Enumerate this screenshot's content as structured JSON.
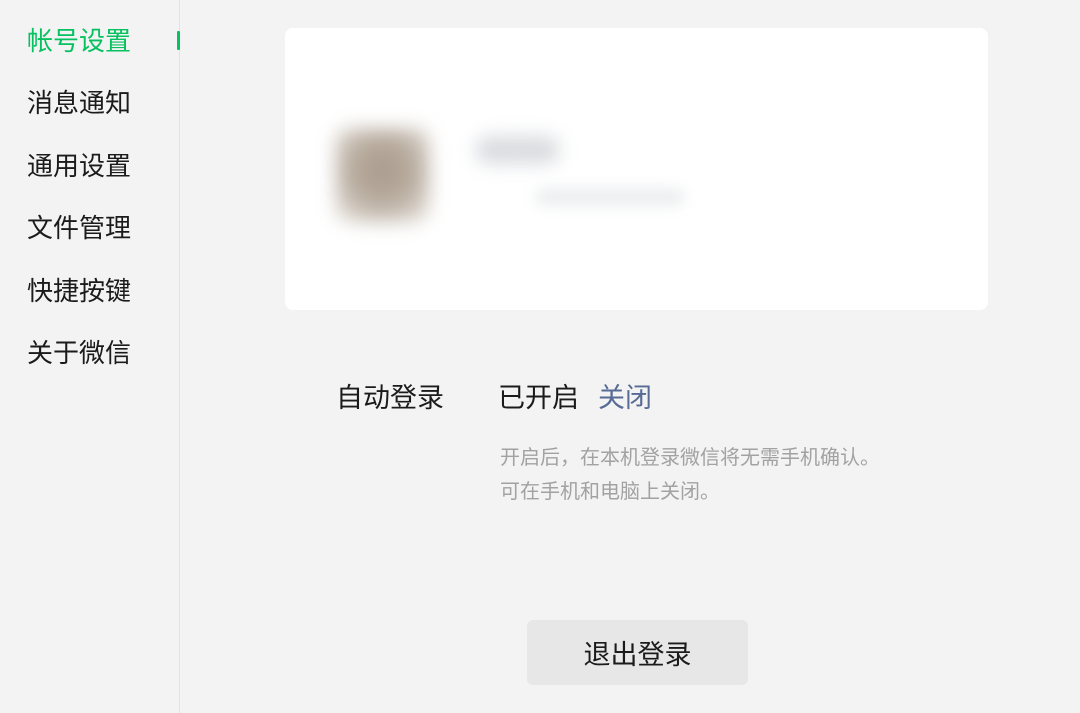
{
  "sidebar": {
    "items": [
      {
        "label": "帐号设置",
        "active": true
      },
      {
        "label": "消息通知",
        "active": false
      },
      {
        "label": "通用设置",
        "active": false
      },
      {
        "label": "文件管理",
        "active": false
      },
      {
        "label": "快捷按键",
        "active": false
      },
      {
        "label": "关于微信",
        "active": false
      }
    ]
  },
  "account": {
    "auto_login": {
      "label": "自动登录",
      "status": "已开启",
      "action": "关闭",
      "hint_line1": "开启后，在本机登录微信将无需手机确认。",
      "hint_line2": "可在手机和电脑上关闭。"
    },
    "logout_label": "退出登录"
  },
  "colors": {
    "accent": "#07c160",
    "link": "#576b95",
    "hint": "#a2a2a2",
    "background": "#f3f3f3"
  }
}
